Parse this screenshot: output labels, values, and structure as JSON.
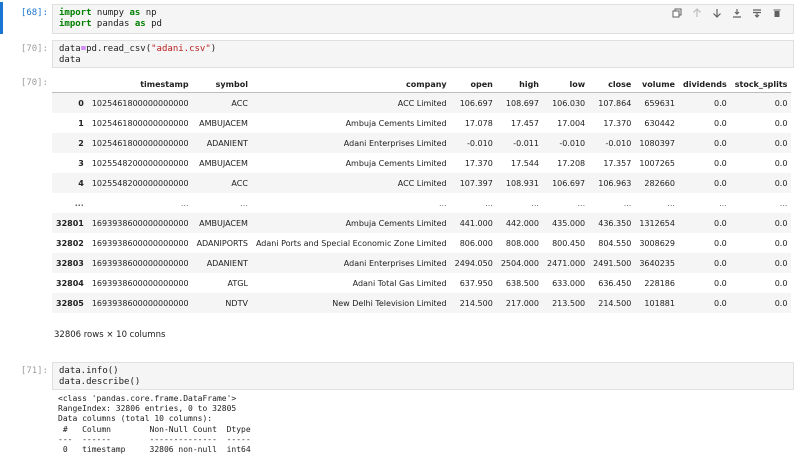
{
  "cells": [
    {
      "prompt": "[68]:",
      "lines": [
        "import numpy as np",
        "import pandas as pd"
      ]
    },
    {
      "prompt": "[70]:",
      "lines": [
        "data=pd.read_csv(\"adani.csv\")",
        "data"
      ],
      "out_prompt": "[70]:"
    },
    {
      "prompt": "[71]:",
      "lines": [
        "data.info()",
        "data.describe()"
      ]
    }
  ],
  "toolbar": {
    "icons": [
      "copy-icon",
      "move-up-icon",
      "move-down-icon",
      "insert-below-icon",
      "merge-icon",
      "delete-icon"
    ]
  },
  "table": {
    "columns": [
      "",
      "timestamp",
      "symbol",
      "company",
      "open",
      "high",
      "low",
      "close",
      "volume",
      "dividends",
      "stock_splits"
    ],
    "rows": [
      [
        "0",
        "1025461800000000000",
        "ACC",
        "ACC Limited",
        "106.697",
        "108.697",
        "106.030",
        "107.864",
        "659631",
        "0.0",
        "0.0"
      ],
      [
        "1",
        "1025461800000000000",
        "AMBUJACEM",
        "Ambuja Cements Limited",
        "17.078",
        "17.457",
        "17.004",
        "17.370",
        "630442",
        "0.0",
        "0.0"
      ],
      [
        "2",
        "1025461800000000000",
        "ADANIENT",
        "Adani Enterprises Limited",
        "-0.010",
        "-0.011",
        "-0.010",
        "-0.010",
        "1080397",
        "0.0",
        "0.0"
      ],
      [
        "3",
        "1025548200000000000",
        "AMBUJACEM",
        "Ambuja Cements Limited",
        "17.370",
        "17.544",
        "17.208",
        "17.357",
        "1007265",
        "0.0",
        "0.0"
      ],
      [
        "4",
        "1025548200000000000",
        "ACC",
        "ACC Limited",
        "107.397",
        "108.931",
        "106.697",
        "106.963",
        "282660",
        "0.0",
        "0.0"
      ],
      [
        "...",
        "...",
        "...",
        "...",
        "...",
        "...",
        "...",
        "...",
        "...",
        "...",
        "..."
      ],
      [
        "32801",
        "1693938600000000000",
        "AMBUJACEM",
        "Ambuja Cements Limited",
        "441.000",
        "442.000",
        "435.000",
        "436.350",
        "1312654",
        "0.0",
        "0.0"
      ],
      [
        "32802",
        "1693938600000000000",
        "ADANIPORTS",
        "Adani Ports and Special Economic Zone Limited",
        "806.000",
        "808.000",
        "800.450",
        "804.550",
        "3008629",
        "0.0",
        "0.0"
      ],
      [
        "32803",
        "1693938600000000000",
        "ADANIENT",
        "Adani Enterprises Limited",
        "2494.050",
        "2504.000",
        "2471.000",
        "2491.500",
        "3640235",
        "0.0",
        "0.0"
      ],
      [
        "32804",
        "1693938600000000000",
        "ATGL",
        "Adani Total Gas Limited",
        "637.950",
        "638.500",
        "633.000",
        "636.450",
        "228186",
        "0.0",
        "0.0"
      ],
      [
        "32805",
        "1693938600000000000",
        "NDTV",
        "New Delhi Television Limited",
        "214.500",
        "217.000",
        "213.500",
        "214.500",
        "101881",
        "0.0",
        "0.0"
      ]
    ],
    "shape": "32806 rows × 10 columns"
  },
  "info_output": "<class 'pandas.core.frame.DataFrame'>\nRangeIndex: 32806 entries, 0 to 32805\nData columns (total 10 columns):\n #   Column        Non-Null Count  Dtype \n---  ------        --------------  ----- \n 0   timestamp     32806 non-null  int64"
}
